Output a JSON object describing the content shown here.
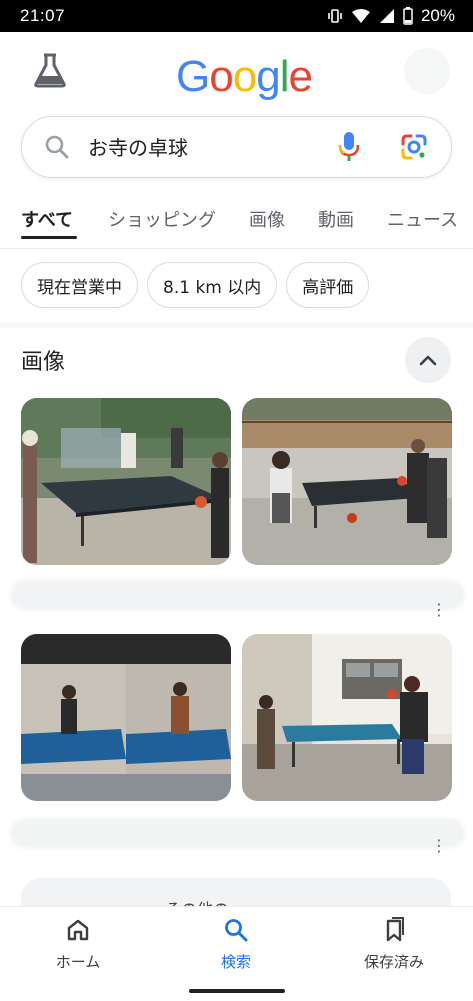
{
  "status_bar": {
    "time": "21:07",
    "battery": "20%"
  },
  "header": {
    "logo": [
      "G",
      "o",
      "o",
      "g",
      "l",
      "e"
    ]
  },
  "search": {
    "query": "お寺の卓球"
  },
  "tabs": [
    {
      "label": "すべて"
    },
    {
      "label": "ショッピング"
    },
    {
      "label": "画像"
    },
    {
      "label": "動画"
    },
    {
      "label": "ニュース"
    }
  ],
  "chips": [
    {
      "label": "現在営業中"
    },
    {
      "label": "8.1 km 以内"
    },
    {
      "label": "高評価"
    }
  ],
  "images_section": {
    "title": "画像"
  },
  "other_section": {
    "label": "その他の"
  },
  "bottom_nav": {
    "home": "ホーム",
    "search": "検索",
    "saved": "保存済み"
  },
  "colors": {
    "accent": "#1a73e8",
    "text": "#202124",
    "muted": "#5f6368"
  }
}
